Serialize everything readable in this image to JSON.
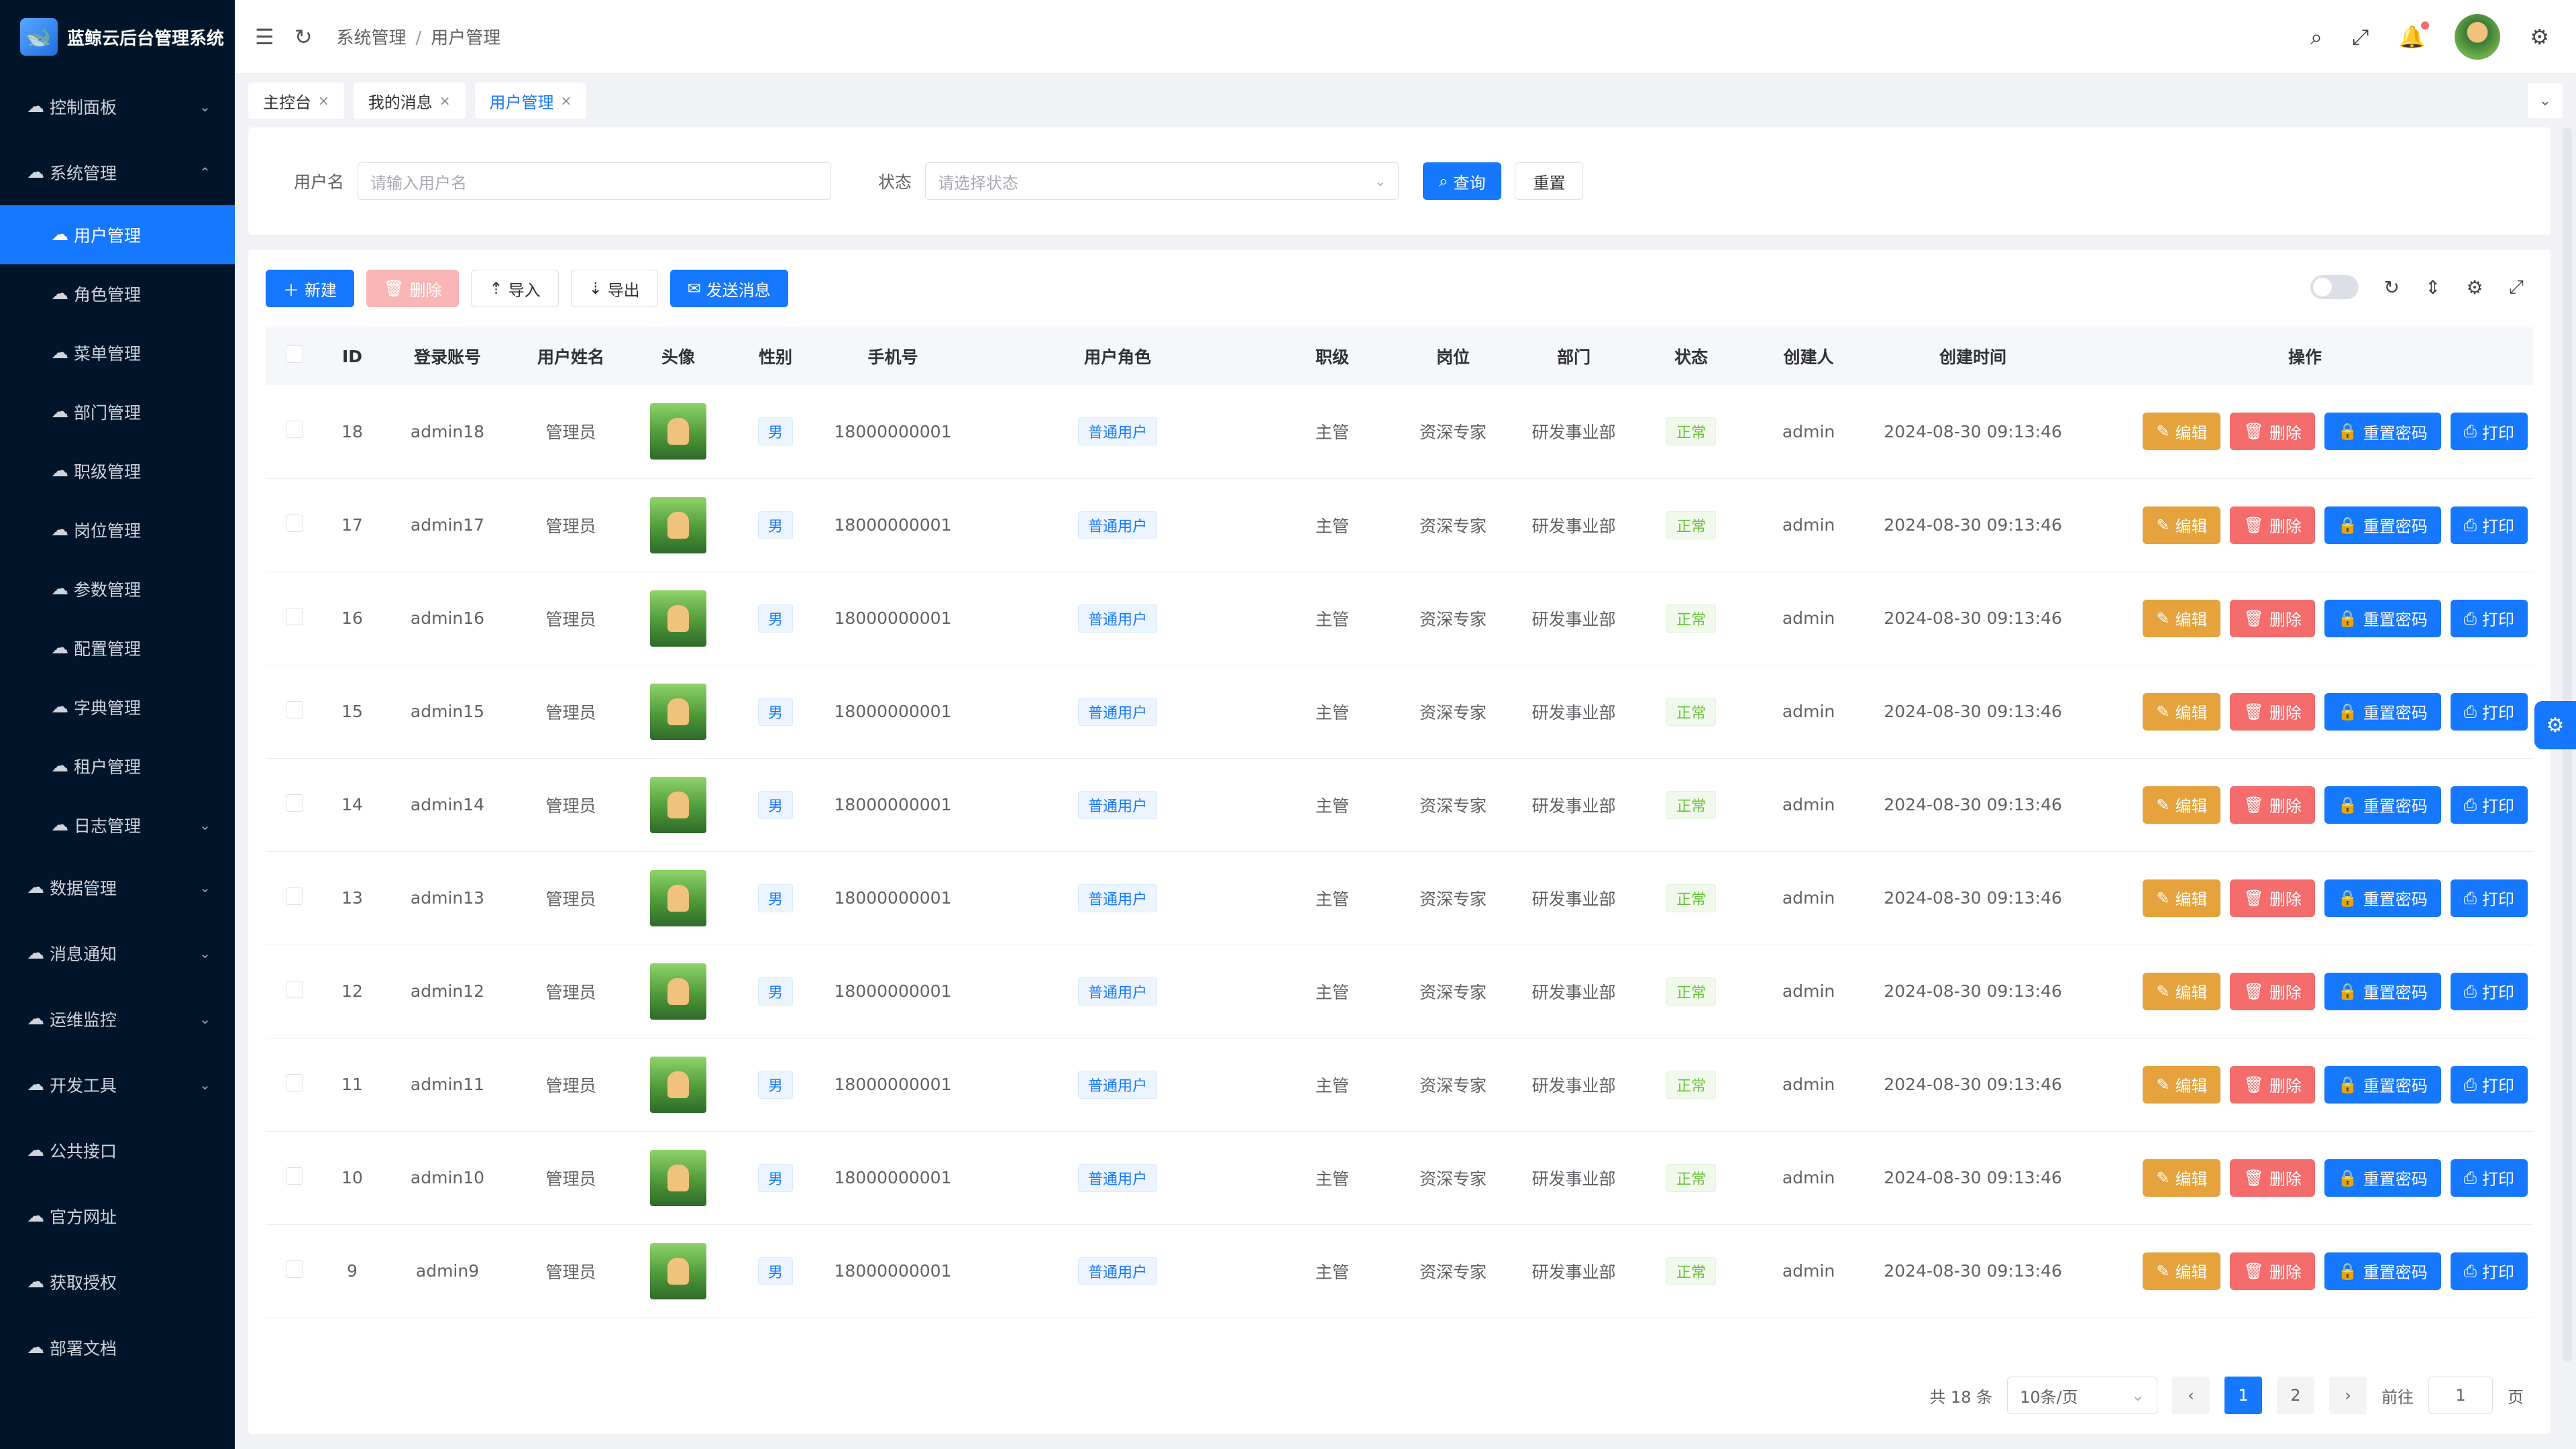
{
  "app": {
    "title": "蓝鲸云后台管理系统",
    "logo_icon": "whale-logo"
  },
  "sidebar": {
    "items": [
      {
        "label": "控制面板",
        "icon": "cloud-icon",
        "expandable": true
      },
      {
        "label": "系统管理",
        "icon": "cloud-icon",
        "expandable": true,
        "expanded": true,
        "children": [
          {
            "label": "用户管理",
            "active": true
          },
          {
            "label": "角色管理"
          },
          {
            "label": "菜单管理"
          },
          {
            "label": "部门管理"
          },
          {
            "label": "职级管理"
          },
          {
            "label": "岗位管理"
          },
          {
            "label": "参数管理"
          },
          {
            "label": "配置管理"
          },
          {
            "label": "字典管理"
          },
          {
            "label": "租户管理"
          },
          {
            "label": "日志管理",
            "expandable": true
          }
        ]
      },
      {
        "label": "数据管理",
        "icon": "cloud-icon",
        "expandable": true
      },
      {
        "label": "消息通知",
        "icon": "cloud-icon",
        "expandable": true
      },
      {
        "label": "运维监控",
        "icon": "cloud-icon",
        "expandable": true
      },
      {
        "label": "开发工具",
        "icon": "cloud-icon",
        "expandable": true
      },
      {
        "label": "公共接口",
        "icon": "cloud-icon"
      },
      {
        "label": "官方网址",
        "icon": "cloud-icon"
      },
      {
        "label": "获取授权",
        "icon": "cloud-icon"
      },
      {
        "label": "部署文档",
        "icon": "cloud-icon"
      }
    ]
  },
  "header": {
    "breadcrumb": [
      "系统管理",
      "用户管理"
    ],
    "icons": [
      "menu-fold-icon",
      "refresh-icon",
      "search-icon",
      "fullscreen-icon",
      "bell-icon",
      "avatar",
      "gear-icon"
    ]
  },
  "tabs": [
    {
      "label": "主控台",
      "active": false
    },
    {
      "label": "我的消息",
      "active": false
    },
    {
      "label": "用户管理",
      "active": true
    }
  ],
  "search": {
    "username_label": "用户名",
    "username_placeholder": "请输入用户名",
    "status_label": "状态",
    "status_placeholder": "请选择状态",
    "query_label": "查询",
    "reset_label": "重置"
  },
  "toolbar": {
    "new_label": "新建",
    "delete_label": "删除",
    "import_label": "导入",
    "export_label": "导出",
    "send_label": "发送消息"
  },
  "table": {
    "columns": [
      "ID",
      "登录账号",
      "用户姓名",
      "头像",
      "性别",
      "手机号",
      "用户角色",
      "职级",
      "岗位",
      "部门",
      "状态",
      "创建人",
      "创建时间",
      "操作"
    ],
    "rows": [
      {
        "id": "18",
        "account": "admin18",
        "name": "管理员",
        "gender": "男",
        "phone": "18000000001",
        "role": "普通用户",
        "rank": "主管",
        "post": "资深专家",
        "dept": "研发事业部",
        "status": "正常",
        "creator": "admin",
        "created": "2024-08-30 09:13:46"
      },
      {
        "id": "17",
        "account": "admin17",
        "name": "管理员",
        "gender": "男",
        "phone": "18000000001",
        "role": "普通用户",
        "rank": "主管",
        "post": "资深专家",
        "dept": "研发事业部",
        "status": "正常",
        "creator": "admin",
        "created": "2024-08-30 09:13:46"
      },
      {
        "id": "16",
        "account": "admin16",
        "name": "管理员",
        "gender": "男",
        "phone": "18000000001",
        "role": "普通用户",
        "rank": "主管",
        "post": "资深专家",
        "dept": "研发事业部",
        "status": "正常",
        "creator": "admin",
        "created": "2024-08-30 09:13:46"
      },
      {
        "id": "15",
        "account": "admin15",
        "name": "管理员",
        "gender": "男",
        "phone": "18000000001",
        "role": "普通用户",
        "rank": "主管",
        "post": "资深专家",
        "dept": "研发事业部",
        "status": "正常",
        "creator": "admin",
        "created": "2024-08-30 09:13:46"
      },
      {
        "id": "14",
        "account": "admin14",
        "name": "管理员",
        "gender": "男",
        "phone": "18000000001",
        "role": "普通用户",
        "rank": "主管",
        "post": "资深专家",
        "dept": "研发事业部",
        "status": "正常",
        "creator": "admin",
        "created": "2024-08-30 09:13:46"
      },
      {
        "id": "13",
        "account": "admin13",
        "name": "管理员",
        "gender": "男",
        "phone": "18000000001",
        "role": "普通用户",
        "rank": "主管",
        "post": "资深专家",
        "dept": "研发事业部",
        "status": "正常",
        "creator": "admin",
        "created": "2024-08-30 09:13:46"
      },
      {
        "id": "12",
        "account": "admin12",
        "name": "管理员",
        "gender": "男",
        "phone": "18000000001",
        "role": "普通用户",
        "rank": "主管",
        "post": "资深专家",
        "dept": "研发事业部",
        "status": "正常",
        "creator": "admin",
        "created": "2024-08-30 09:13:46"
      },
      {
        "id": "11",
        "account": "admin11",
        "name": "管理员",
        "gender": "男",
        "phone": "18000000001",
        "role": "普通用户",
        "rank": "主管",
        "post": "资深专家",
        "dept": "研发事业部",
        "status": "正常",
        "creator": "admin",
        "created": "2024-08-30 09:13:46"
      },
      {
        "id": "10",
        "account": "admin10",
        "name": "管理员",
        "gender": "男",
        "phone": "18000000001",
        "role": "普通用户",
        "rank": "主管",
        "post": "资深专家",
        "dept": "研发事业部",
        "status": "正常",
        "creator": "admin",
        "created": "2024-08-30 09:13:46"
      },
      {
        "id": "9",
        "account": "admin9",
        "name": "管理员",
        "gender": "男",
        "phone": "18000000001",
        "role": "普通用户",
        "rank": "主管",
        "post": "资深专家",
        "dept": "研发事业部",
        "status": "正常",
        "creator": "admin",
        "created": "2024-08-30 09:13:46"
      }
    ],
    "actions": {
      "edit": "编辑",
      "delete": "删除",
      "reset_pwd": "重置密码",
      "print": "打印"
    }
  },
  "pagination": {
    "total_text": "共 18 条",
    "page_size": "10条/页",
    "pages": [
      "1",
      "2"
    ],
    "current": "1",
    "goto_label": "前往",
    "goto_value": "1",
    "page_suffix": "页"
  },
  "colors": {
    "primary": "#1677ff",
    "sidebar_bg": "#001529",
    "warning": "#e6a23c",
    "danger": "#f56c6c",
    "success": "#67c23a"
  }
}
